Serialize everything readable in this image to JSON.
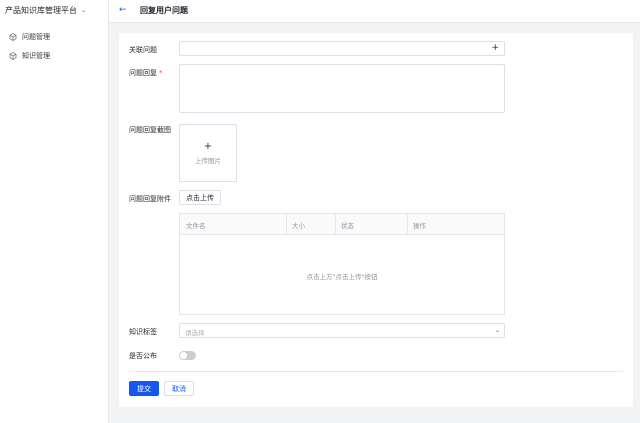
{
  "sidebar": {
    "brand": "产品知识库管理平台",
    "items": [
      {
        "label": "问题管理",
        "icon": "cube-icon"
      },
      {
        "label": "知识管理",
        "icon": "cube-icon"
      }
    ]
  },
  "header": {
    "back_icon": "←",
    "title": "回复用户问题"
  },
  "form": {
    "related_question_label": "关联问题",
    "related_question_plus": "+",
    "reply_label": "问题回复",
    "required_mark": "*",
    "screenshot_label": "问题回复截图",
    "upload_plus": "+",
    "upload_text": "上传图片",
    "attachment_label": "问题回复附件",
    "upload_button": "点击上传",
    "table": {
      "columns": [
        "文件名",
        "大小",
        "状态",
        "操作"
      ],
      "empty_text": "点击上方\"点击上传\"按钮"
    },
    "tag_label": "知识标签",
    "tag_placeholder": "请选择",
    "publish_label": "是否公布",
    "publish_value": false,
    "submit": "提交",
    "cancel": "取消"
  },
  "colors": {
    "primary": "#1456f0",
    "required": "#f54a45"
  }
}
